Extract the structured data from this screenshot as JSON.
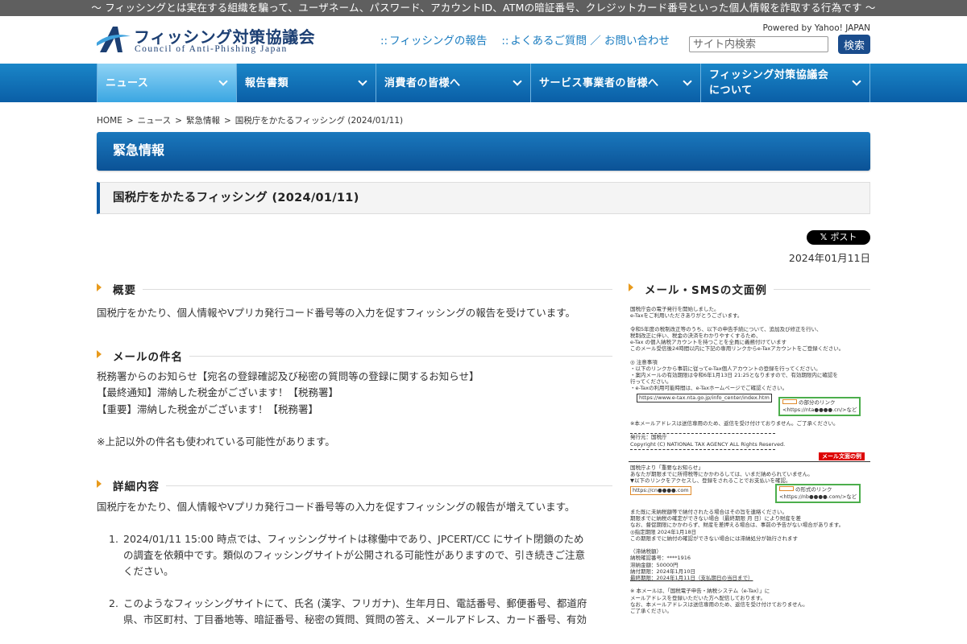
{
  "topbar": {
    "text": "〜 フィッシングとは実在する組織を騙って、ユーザネーム、パスワード、アカウントID、ATMの暗証番号、クレジットカード番号といった個人情報を詐取する行為です 〜"
  },
  "header": {
    "logo_jp": "フィッシング対策協議会",
    "logo_en": "Council of Anti-Phishing Japan",
    "links": [
      {
        "mark": "::",
        "label": "フィッシングの報告"
      },
      {
        "mark": "::",
        "label": "よくあるご質問 ／ お問い合わせ"
      }
    ],
    "powered_by": "Powered by Yahoo! JAPAN",
    "search_placeholder": "サイト内検索",
    "search_button": "検索"
  },
  "nav": {
    "items": [
      {
        "label": "ニュース",
        "active": true
      },
      {
        "label": "報告書類"
      },
      {
        "label": "消費者の皆様へ"
      },
      {
        "label": "サービス事業者の皆様へ"
      },
      {
        "label_line1": "フィッシング対策協議会",
        "label_line2": "について"
      }
    ]
  },
  "breadcrumb": {
    "items": [
      "HOME",
      "ニュース",
      "緊急情報",
      "国税庁をかたるフィッシング (2024/01/11)"
    ],
    "separator": ">"
  },
  "category_banner": "緊急情報",
  "page_title": "国税庁をかたるフィッシング (2024/01/11)",
  "share": {
    "icon": "x-logo-icon",
    "label": "ポスト"
  },
  "date": "2024年01月11日",
  "sections": {
    "overview": {
      "heading": "概要",
      "text": "国税庁をかたり、個人情報やVプリカ発行コード番号等の入力を促すフィッシングの報告を受けています。"
    },
    "subjects": {
      "heading": "メールの件名",
      "lines": [
        "税務署からのお知らせ【宛名の登録確認及び秘密の質問等の登録に関するお知らせ】",
        "【最終通知】滞納した税金がございます！【税務署】",
        "【重要】滞納した税金がございます！【税務署】"
      ],
      "note": "※上記以外の件名も使われている可能性があります。"
    },
    "details": {
      "heading": "詳細内容",
      "intro": "国税庁をかたり、個人情報やVプリカ発行コード番号等の入力を促すフィッシングの報告が増えています。",
      "items": [
        {
          "num": "1.",
          "lines": [
            "2024/01/11 15:00 時点では、フィッシングサイトは稼働中であり、JPCERT/CC にサイト閉鎖のため",
            "の調査を依頼中です。類似のフィッシングサイトが公開される可能性がありますので、引き続きご注意",
            "ください。"
          ]
        },
        {
          "num": "2.",
          "lines": [
            "このようなフィッシングサイトにて、氏名 (漢字、フリガナ)、生年月日、電話番号、郵便番号、都道府",
            "県、市区町村、丁目番地等、暗証番号、秘密の質問、質問の答え、メールアドレス、カード番号、有効"
          ]
        }
      ]
    }
  },
  "sidebar": {
    "heading": "メール・SMSの文面例",
    "sample": {
      "lines_a": [
        "国税庁会の電子発行を開始しました。",
        "e-Taxをご利用いただきありがとうございます。",
        "",
        "令和5年度の税制改正等のうち、以下の申告手続について、追加及び修正を行い、",
        "税制改正に伴い、税金の決済をわかりやすくするため、",
        "e-Tax の個人納税アカウントを持つことを全員に義務付けています",
        "このメール受信後24時間以内に下記の専用リンクからe-Taxアカウントをご登録ください。",
        "",
        "◎ 注意事項",
        "・以下のリンクから事前に従ってe-Tax個人アカウントの登録を行ってください。",
        "・案内メールの有効期限は令和6年1月13日 21:25となりますので、有効期限内に確認を",
        "行ってください。",
        "・e-Taxの利用可能時間は、e-Taxホームページでご確認ください。"
      ],
      "url_box": "https://www.e-tax.nta.go.jp/info_center/index.htm",
      "green1_line1": "の部分のリンク",
      "green1_line2": "<https://nta●●●●.cn/>など",
      "lines_b": [
        "※本メールアドレスは送信専用のため、返信を受け付けておりません。ご了承ください。",
        "",
        "発行元：国税庁",
        "Copyright (C) NATIONAL TAX AGENCY ALL Rights Reserved."
      ],
      "red_label": "メール文面の例",
      "lines_c": [
        "国税庁より「重要なお知らせ」",
        "あなたが期限までに所得税等にかかわるしては、いまだ納められていません。",
        "▼以下のリンクをアクセスし、登録をされることでお支払いを確認。"
      ],
      "orange_url": "https://cn●●●●.com",
      "green2_line1": "の形式のリンク",
      "green2_line2": "<https://nb●●●●.com/>など",
      "lines_d": [
        "また既に未納税額等で納付されたる場合はその旨を連絡ください。",
        "期限までに納税の確定ができない場合（最終期限 月 日）により財産を差",
        "なお、督促期限にかかわらず、財産を差押える場合は、事前の予告がない場合があります。",
        "◎指定期限 2024年1月18日",
        "この期限までに納付の確認ができない場合には滞納処分が執行されます",
        "",
        "（滞納税額）",
        "納税確認番号：****1916",
        "滞納金額：50000円",
        "納付期限：2024年1月10日",
        "最終期限：2024年1月11日（支払期日の当日まで）",
        "",
        "※ 本メールは、「国税電子申告・納税システム（e-Tax）」に",
        "メールアドレスを登録いただいた方へ配信しております。",
        "なお、本メールアドレスは送信専用のため、返信を受け付けておりません。",
        "ご了承ください。"
      ]
    }
  },
  "colors": {
    "nav_blue": "#0a5ea6",
    "nav_active": "#3aa6e2",
    "accent_orange": "#e89a1c",
    "link_blue": "#1a7cc0"
  }
}
